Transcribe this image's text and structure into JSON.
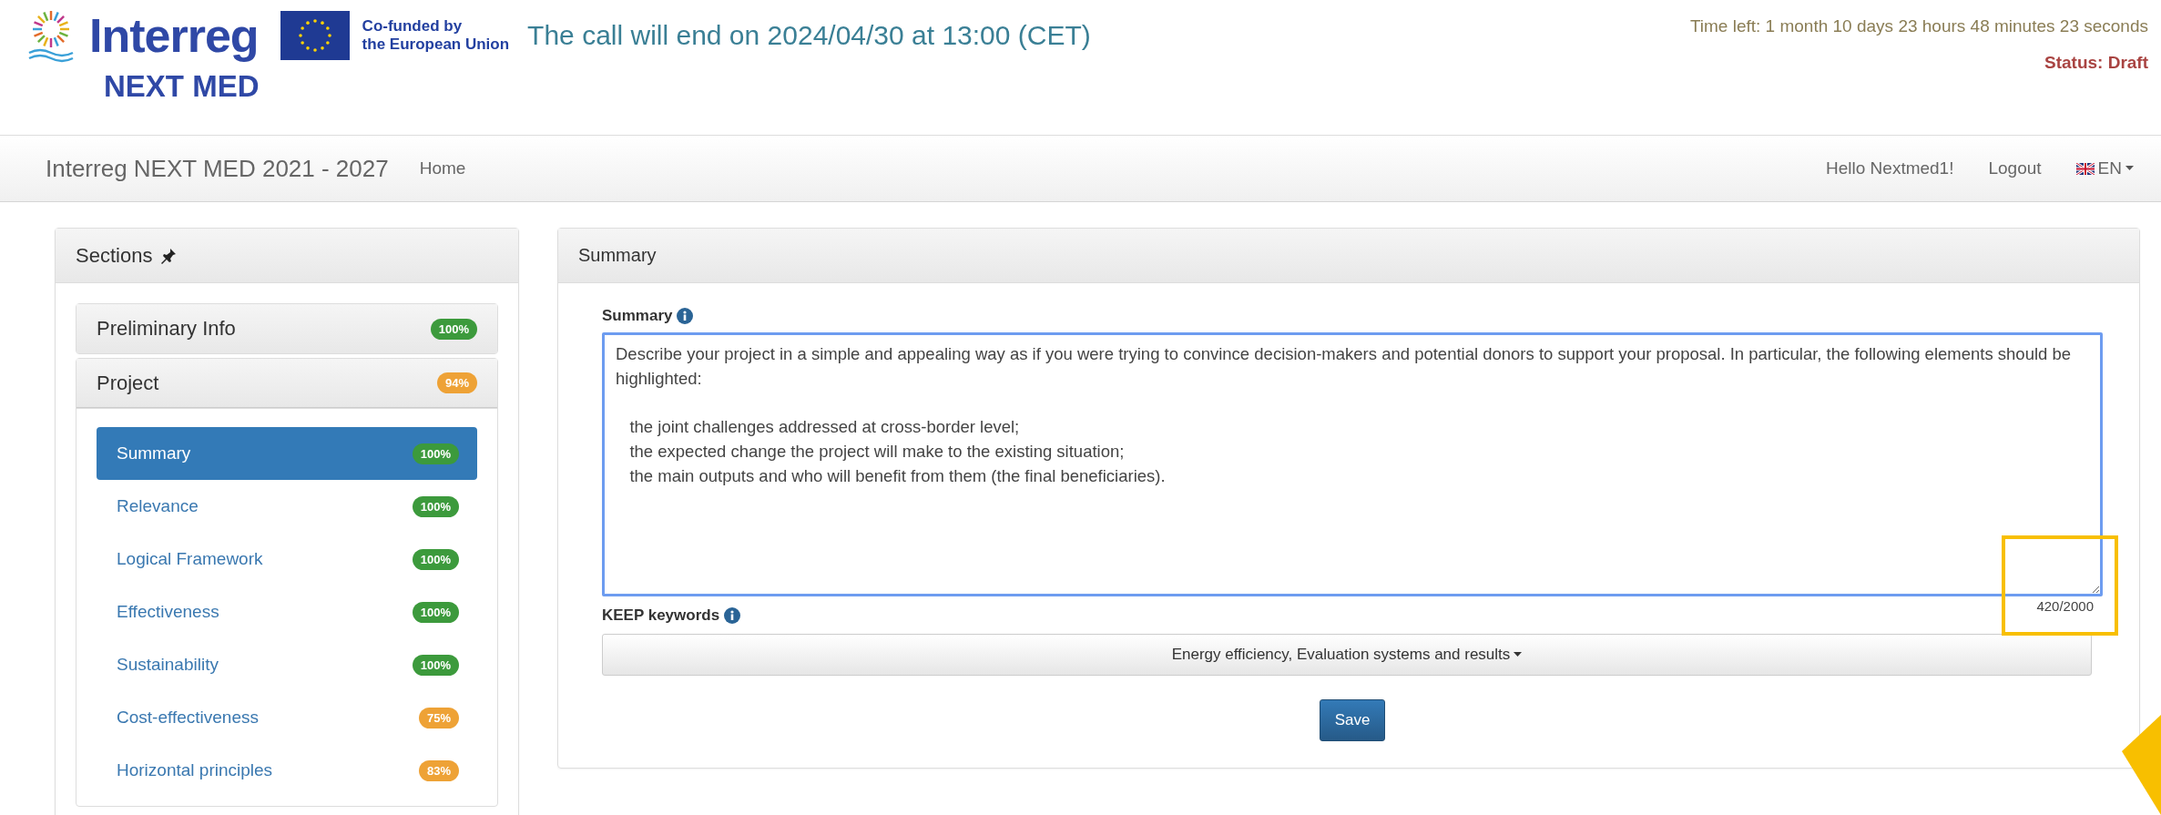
{
  "header": {
    "logo_name": "Interreg",
    "logo_subtitle": "NEXT MED",
    "eu_label": [
      "Co-funded by",
      "the European Union"
    ],
    "call_end": "The call will end on 2024/04/30 at 13:00 (CET)",
    "time_left": "Time left: 1 month 10 days 23 hours 48 minutes 23 seconds",
    "status": "Status: Draft"
  },
  "navbar": {
    "brand": "Interreg NEXT MED 2021 - 2027",
    "links": [
      "Home"
    ],
    "greeting": "Hello Nextmed1!",
    "logout": "Logout",
    "language": "EN"
  },
  "sidebar": {
    "title": "Sections",
    "groups": [
      {
        "label": "Preliminary Info",
        "badge": "100%",
        "color": "#3c9a3c"
      },
      {
        "label": "Project",
        "badge": "94%",
        "color": "#eea236",
        "expanded": true,
        "items": [
          {
            "label": "Summary",
            "badge": "100%",
            "color": "#3c9a3c",
            "selected": true
          },
          {
            "label": "Relevance",
            "badge": "100%",
            "color": "#3c9a3c",
            "selected": false
          },
          {
            "label": "Logical Framework",
            "badge": "100%",
            "color": "#3c9a3c",
            "selected": false
          },
          {
            "label": "Effectiveness",
            "badge": "100%",
            "color": "#3c9a3c",
            "selected": false
          },
          {
            "label": "Sustainability",
            "badge": "100%",
            "color": "#3c9a3c",
            "selected": false
          },
          {
            "label": "Cost-effectiveness",
            "badge": "75%",
            "color": "#eea236",
            "selected": false
          },
          {
            "label": "Horizontal principles",
            "badge": "83%",
            "color": "#eea236",
            "selected": false
          }
        ]
      }
    ]
  },
  "main": {
    "title": "Summary",
    "summary_label": "Summary",
    "summary_value": "Describe your project in a simple and appealing way as if you were trying to convince decision-makers and potential donors to support your proposal. In particular, the following elements should be highlighted:\n\n   the joint challenges addressed at cross-border level;\n   the expected change the project will make to the existing situation;\n   the main outputs and who will benefit from them (the final beneficiaries).",
    "counter": "420/2000",
    "keywords_label": "KEEP keywords",
    "keywords_value": "Energy efficiency, Evaluation systems and results",
    "save": "Save"
  }
}
